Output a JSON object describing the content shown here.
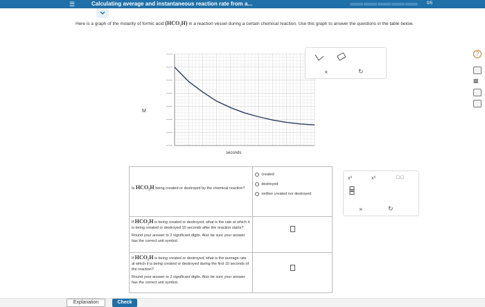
{
  "header": {
    "title": "Calculating average and instantaneous reaction rate from a...",
    "progress_count": "0/5",
    "progress_fraction": 0.0,
    "bar_color": "#1f6fa8"
  },
  "prompt": {
    "before": "Here is a graph of the molarity of formic acid",
    "formula": "(HCO₂H)",
    "after": "in a reaction vessel during a certain chemical reaction. Use this graph to answer the questions in the table below."
  },
  "chart_data": {
    "type": "line",
    "ylabel": "M",
    "xlabel": "seconds",
    "series": [
      {
        "values": [
          0.06,
          0.049,
          0.041,
          0.034,
          0.029,
          0.025,
          0.022,
          0.0195,
          0.0177,
          0.0165,
          0.0158
        ]
      }
    ],
    "x": [
      0,
      10,
      20,
      30,
      40,
      50,
      60,
      70,
      80,
      90,
      100
    ],
    "ylim": [
      0,
      0.07
    ],
    "xlim": [
      0,
      100
    ],
    "grid": true,
    "line_color": "#2a3a5c"
  },
  "graph_tools": {
    "line_icon": "line-tool-icon",
    "eraser_icon": "eraser-icon",
    "clear": "×",
    "reset": "↻"
  },
  "questions": [
    {
      "prefix": "Is",
      "formula": "HCO₂H",
      "text": "being created or destroyed by the chemical reaction?",
      "options": [
        "created",
        "destroyed",
        "neither created nor destroyed"
      ]
    },
    {
      "prefix": "If",
      "formula": "HCO₂H",
      "text": "is being created or destroyed, what is the rate at which it is being created or destroyed 10 seconds after the reaction starts?",
      "note": "Round your answer to 2 significant digits. Also be sure your answer has the correct unit symbol.",
      "answer": ""
    },
    {
      "prefix": "If",
      "formula": "HCO₂H",
      "text": "is being created or destroyed, what is the average rate at which it is being created or destroyed during the first 10 seconds of the reaction?",
      "note": "Round your answer to 2 significant digits. Also be sure your answer has the correct unit symbol.",
      "answer": ""
    }
  ],
  "answer_tools": {
    "superscript": "x⁰",
    "fraction": "frac",
    "multiply": "□·□",
    "clear": "×",
    "reset": "↻"
  },
  "side": {
    "help": "?"
  },
  "footer": {
    "explanation": "Explanation",
    "check": "Check"
  }
}
